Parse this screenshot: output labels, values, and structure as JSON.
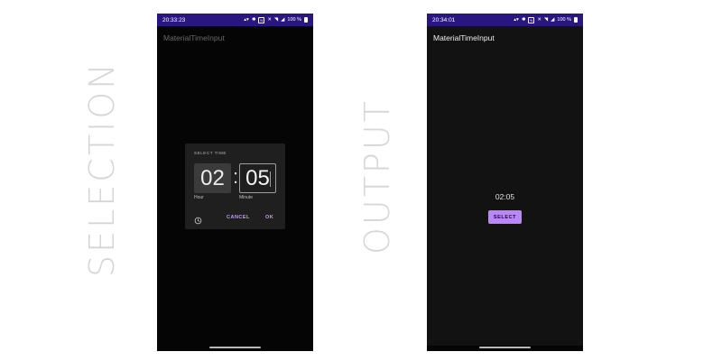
{
  "labels": {
    "selection": "SELECTION",
    "output": "OUTPUT"
  },
  "left_phone": {
    "status": {
      "time": "20:33:23",
      "battery": "100 %"
    },
    "app_title": "MaterialTimeInput",
    "dialog": {
      "title": "SELECT TIME",
      "hour": "02",
      "separator": ":",
      "minute": "05",
      "hour_caption": "Hour",
      "minute_caption": "Minute",
      "cancel_label": "CANCEL",
      "ok_label": "OK",
      "mode_icon": "clock-icon"
    }
  },
  "right_phone": {
    "status": {
      "time": "20:34:01",
      "battery": "100 %"
    },
    "app_title": "MaterialTimeInput",
    "selected_time": "02:05",
    "select_label": "SELECT"
  },
  "colors": {
    "status_bar": "#2a1680",
    "accent": "#bb86fc",
    "dialog_bg": "#1f1f1f",
    "screen_bg": "#121212"
  }
}
